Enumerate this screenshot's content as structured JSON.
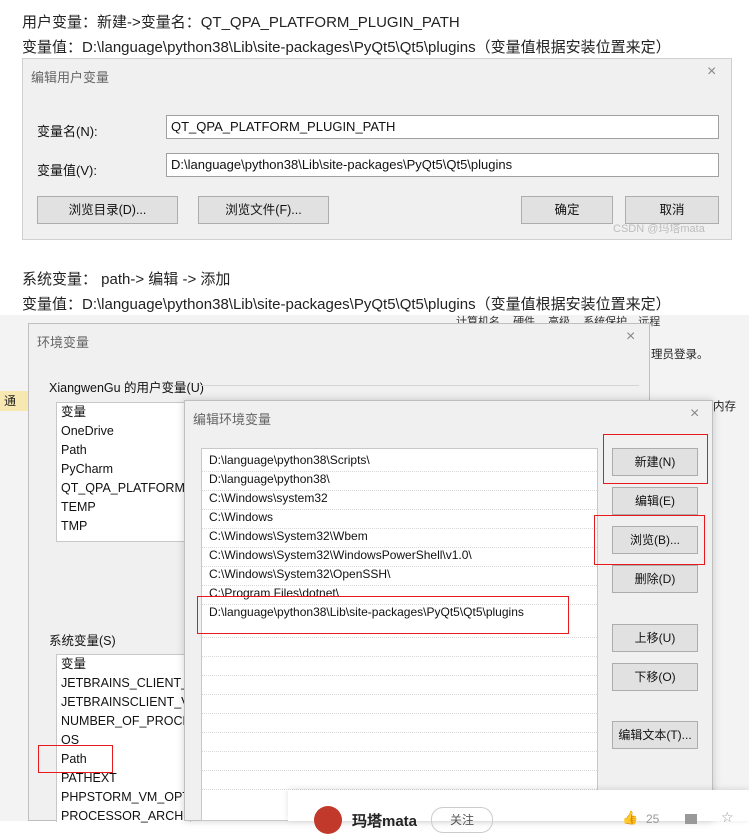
{
  "article": {
    "line1": "用户变量：新建->变量名：QT_QPA_PLATFORM_PLUGIN_PATH",
    "line2": "变量值：D:\\language\\python38\\Lib\\site-packages\\PyQt5\\Qt5\\plugins（变量值根据安装位置来定）",
    "line3": "系统变量： path-> 编辑 -> 添加",
    "line4": "变量值：D:\\language\\python38\\Lib\\site-packages\\PyQt5\\Qt5\\plugins（变量值根据安装位置来定）"
  },
  "user_var_dialog": {
    "title": "编辑用户变量",
    "close": "×",
    "name_label": "变量名(N):",
    "name_value": "QT_QPA_PLATFORM_PLUGIN_PATH",
    "value_label": "变量值(V):",
    "value_value": "D:\\language\\python38\\Lib\\site-packages\\PyQt5\\Qt5\\plugins",
    "browse_dir": "浏览目录(D)...",
    "browse_file": "浏览文件(F)...",
    "ok": "确定",
    "cancel": "取消",
    "watermark": "CSDN @玛塔mata"
  },
  "background_window": {
    "tabs": [
      "计算机名",
      "硬件",
      "高级",
      "系统保护",
      "远程"
    ],
    "admin_text": "理员登录。",
    "side_text": "内存",
    "left_char": "通"
  },
  "env_dialog": {
    "title": "环境变量",
    "close": "×",
    "user_group": "XiangwenGu 的用户变量(U)",
    "user_header": "变量",
    "user_items": [
      "OneDrive",
      "Path",
      "PyCharm",
      "QT_QPA_PLATFORM_",
      "TEMP",
      "TMP"
    ],
    "system_group": "系统变量(S)",
    "system_header": "变量",
    "system_items": [
      "JETBRAINS_CLIENT_VM",
      "JETBRAINSCLIENT_VM",
      "NUMBER_OF_PROCES",
      "OS",
      "Path",
      "PATHEXT",
      "PHPSTORM_VM_OPTI",
      "PROCESSOR_ARCHITE"
    ]
  },
  "edit_env_dialog": {
    "title": "编辑环境变量",
    "close": "×",
    "paths": [
      "D:\\language\\python38\\Scripts\\",
      "D:\\language\\python38\\",
      "C:\\Windows\\system32",
      "C:\\Windows",
      "C:\\Windows\\System32\\Wbem",
      "C:\\Windows\\System32\\WindowsPowerShell\\v1.0\\",
      "C:\\Windows\\System32\\OpenSSH\\",
      "C:\\Program Files\\dotnet\\",
      "D:\\language\\python38\\Lib\\site-packages\\PyQt5\\Qt5\\plugins"
    ],
    "buttons": {
      "new": "新建(N)",
      "edit": "编辑(E)",
      "browse": "浏览(B)...",
      "delete": "删除(D)",
      "up": "上移(U)",
      "down": "下移(O)",
      "edit_text": "编辑文本(T)..."
    }
  },
  "footer": {
    "author": "玛塔mata",
    "follow": "关注",
    "likes": "25"
  },
  "colors": {
    "highlight_red": "#e8191c",
    "dialog_bg": "#f0f0f0",
    "button_bg": "#e1e1e1"
  }
}
